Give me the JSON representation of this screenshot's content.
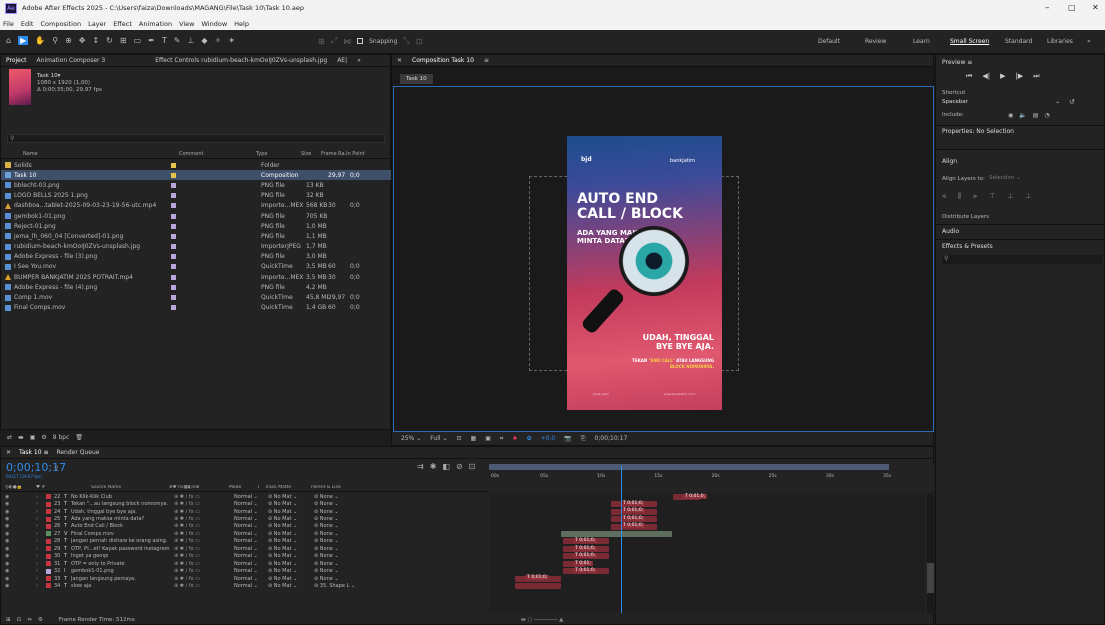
{
  "app": {
    "title": "Adobe After Effects 2025 - C:\\Users\\faiza\\Downloads\\MAGANG\\File\\Task 10\\Task 10.aep",
    "logo": "Ae",
    "menu": [
      "File",
      "Edit",
      "Composition",
      "Layer",
      "Effect",
      "Animation",
      "View",
      "Window",
      "Help"
    ],
    "window_controls": {
      "minimize": "–",
      "restore": "▢",
      "close": "✕"
    }
  },
  "toolbar": {
    "snapping": "Snapping",
    "workspaces": [
      "Default",
      "Review",
      "Learn",
      "Small Screen",
      "Standard",
      "Libraries"
    ],
    "active_workspace": "Small Screen",
    "more": "»"
  },
  "project": {
    "tabs": [
      "Project",
      "Animation Composer 3",
      "Effect Controls rubidium-beach-kmOoIJ0ZVs-unsplash.jpg",
      "AE|",
      "»"
    ],
    "preview_name": "Task 10▾",
    "preview_dims": "1080 x 1920 (1,00)",
    "preview_dur": "Δ 0;00;35;00, 29,97 fps",
    "search_placeholder": "",
    "columns": [
      "Name",
      "Comment",
      "Type",
      "Size",
      "Frame Ra...",
      "In Point"
    ],
    "items": [
      {
        "name": "Solids",
        "type": "Folder",
        "size": "",
        "fps": "",
        "in": "",
        "icon": "folder-icon",
        "label": "#e6c34a"
      },
      {
        "name": "Task 10",
        "type": "Composition",
        "size": "",
        "fps": "29,97",
        "in": "0;0",
        "icon": "composition-icon",
        "label": "#e6c34a",
        "selected": true
      },
      {
        "name": "bblecht-03.png",
        "type": "PNG file",
        "size": "13 KB",
        "fps": "",
        "in": "",
        "icon": "image-icon",
        "label": "#b9a6d9"
      },
      {
        "name": "LOGO BELLS 2025 1.png",
        "type": "PNG file",
        "size": "32 KB",
        "fps": "",
        "in": "",
        "icon": "image-icon",
        "label": "#b9a6d9"
      },
      {
        "name": "dashboa...tablet-2025-09-03-23-19-56-utc.mp4",
        "type": "Importe...MEX",
        "size": "568 KB",
        "fps": "30",
        "in": "0;0",
        "icon": "warning-icon",
        "label": "#b9a6d9"
      },
      {
        "name": "gembok1-01.png",
        "type": "PNG file",
        "size": "705 KB",
        "fps": "",
        "in": "",
        "icon": "image-icon",
        "label": "#b9a6d9"
      },
      {
        "name": "Reject-01.png",
        "type": "PNG file",
        "size": "1,0 MB",
        "fps": "",
        "in": "",
        "icon": "image-icon",
        "label": "#b9a6d9"
      },
      {
        "name": "jema_lh_060_04 [Converted]-01.png",
        "type": "PNG file",
        "size": "1,1 MB",
        "fps": "",
        "in": "",
        "icon": "image-icon",
        "label": "#b9a6d9"
      },
      {
        "name": "rubidium-beach-kmOoIJ0ZVs-unsplash.jpg",
        "type": "ImporterJPEG",
        "size": "1,7 MB",
        "fps": "",
        "in": "",
        "icon": "image-icon",
        "label": "#b9a6d9"
      },
      {
        "name": "Adobe Express - file (3).png",
        "type": "PNG file",
        "size": "3,0 MB",
        "fps": "",
        "in": "",
        "icon": "image-icon",
        "label": "#b9a6d9"
      },
      {
        "name": "I See You.mov",
        "type": "QuickTime",
        "size": "3,5 MB",
        "fps": "60",
        "in": "0;0",
        "icon": "video-icon",
        "label": "#b9a6d9"
      },
      {
        "name": "BUMPER BANKJATIM 2025 POTRAIT.mp4",
        "type": "Importe...MEX",
        "size": "3,5 MB",
        "fps": "30",
        "in": "0;0",
        "icon": "warning-icon",
        "label": "#b9a6d9"
      },
      {
        "name": "Adobe Express - file (4).png",
        "type": "PNG file",
        "size": "4,2 MB",
        "fps": "",
        "in": "",
        "icon": "image-icon",
        "label": "#b9a6d9"
      },
      {
        "name": "Comp 1.mov",
        "type": "QuickTime",
        "size": "45,8 MB",
        "fps": "29,97",
        "in": "0;0",
        "icon": "video-icon",
        "label": "#b9a6d9"
      },
      {
        "name": "Final Comps.mov",
        "type": "QuickTime",
        "size": "1,4 GB",
        "fps": "60",
        "in": "0;0",
        "icon": "video-icon",
        "label": "#b9a6d9"
      }
    ],
    "footer_bpc": "8 bpc"
  },
  "comp": {
    "tab": "Composition Task 10",
    "sub_tab": "Task 10",
    "poster": {
      "logo_left": "bjd",
      "logo_right": "bankjatim",
      "headline1": "AUTO END",
      "headline2": "CALL / BLOCK",
      "sub1": "ADA YANG MAKSA",
      "sub2": "MINTA DATA?",
      "cta1": "UDAH, TINGGAL",
      "cta2": "BYE BYE AJA.",
      "small_pre": "TEKAN ",
      "small_hl": "\"END CALL\"",
      "small_post": " ATAU LANGSUNG",
      "small2": "BLOCK NOMORNYA.",
      "foot_left": "bank jatim",
      "foot_right": "www.bankjatim.co.id"
    },
    "footer": {
      "zoom": "25%",
      "res": "Full",
      "exposure": "+0,0",
      "time": "0;00;10;17"
    }
  },
  "right": {
    "preview_title": "Preview",
    "shortcut_label": "Shortcut",
    "shortcut_value": "Spacebar",
    "include_label": "Include:",
    "properties_title": "Properties: No Selection",
    "align_title": "Align",
    "align_layers_label": "Align Layers to:",
    "align_layers_value": "Selection",
    "distribute": "Distribute Layers",
    "audio": "Audio",
    "effects": "Effects & Presets"
  },
  "timeline": {
    "tab": "Task 10",
    "render_queue": "Render Queue",
    "timecode": "0;00;10;17",
    "frames": "00317 (29.97 fps)",
    "ruler": [
      "00s",
      "05s",
      "10s",
      "15s",
      "20s",
      "25s",
      "30s",
      "35s"
    ],
    "columns": {
      "source": "Source Name",
      "mode": "Mode",
      "t": "T",
      "trkmat": "Track Matte",
      "parent": "Parent & Link"
    },
    "layers": [
      {
        "num": "22",
        "name": "No Klik-Klik Club",
        "type": "T",
        "color": "#c4363f",
        "mode": "Normal",
        "matte": "No Mat",
        "parent": "None",
        "bar": [
          0.422,
          0.484
        ],
        "tag": "T 0;01;0;"
      },
      {
        "num": "23",
        "name": "Tekan \"...au langsung block nomornya.",
        "type": "T",
        "color": "#c4363f",
        "mode": "Normal",
        "matte": "No Mat",
        "parent": "None",
        "bar": [
          0.28,
          0.385
        ],
        "tag": "T 0;01;0;"
      },
      {
        "num": "24",
        "name": "Udah, tinggal bye bye aja.",
        "type": "T",
        "color": "#c4363f",
        "mode": "Normal",
        "matte": "No Mat",
        "parent": "None",
        "bar": [
          0.28,
          0.385
        ],
        "tag": "T 0;01;0;"
      },
      {
        "num": "25",
        "name": "Ada yang maksa minta data?",
        "type": "T",
        "color": "#c4363f",
        "mode": "Normal",
        "matte": "No Mat",
        "parent": "None",
        "bar": [
          0.28,
          0.385
        ],
        "tag": "T 0;01;0;"
      },
      {
        "num": "26",
        "name": "Auto End Call / Block",
        "type": "T",
        "color": "#c4363f",
        "mode": "Normal",
        "matte": "No Mat",
        "parent": "None",
        "bar": [
          0.28,
          0.385
        ],
        "tag": "T 0;01;0;"
      },
      {
        "num": "27",
        "name": "Final Comps.mov",
        "type": "V",
        "color": "#5d8b5d",
        "mode": "Normal",
        "matte": "No Mat",
        "parent": "None",
        "bar": [
          0.165,
          0.42
        ],
        "tag": ""
      },
      {
        "num": "28",
        "name": "Jangan pernah dishare ke orang asing.",
        "type": "T",
        "color": "#c4363f",
        "mode": "Normal",
        "matte": "No Mat",
        "parent": "None",
        "bar": [
          0.17,
          0.275
        ],
        "tag": "T 0;01;0;"
      },
      {
        "num": "29",
        "name": "OTP, PI...et! Kayak password instagram",
        "type": "T",
        "color": "#c4363f",
        "mode": "Normal",
        "matte": "No Mat",
        "parent": "None",
        "bar": [
          0.17,
          0.275
        ],
        "tag": "T 0;01;0;"
      },
      {
        "num": "30",
        "name": "Inget ya genqs",
        "type": "T",
        "color": "#c4363f",
        "mode": "Normal",
        "matte": "No Mat",
        "parent": "None",
        "bar": [
          0.17,
          0.275
        ],
        "tag": "T 0;01;0;"
      },
      {
        "num": "31",
        "name": "OTP = only to Private",
        "type": "T",
        "color": "#c4363f",
        "mode": "Normal",
        "matte": "No Mat",
        "parent": "None",
        "bar": [
          0.17,
          0.22
        ],
        "tag": "T 0;01;"
      },
      {
        "num": "32",
        "name": "gembok1-01.png",
        "type": "I",
        "color": "#b9a6d9",
        "mode": "Normal",
        "matte": "No Mat",
        "parent": "None",
        "bar": [
          0.17,
          0.275
        ],
        "tag": "T 0;01;0;"
      },
      {
        "num": "33",
        "name": "Jangan langsung percaya.",
        "type": "T",
        "color": "#c4363f",
        "mode": "Normal",
        "matte": "No Mat",
        "parent": "None",
        "bar": [
          0.06,
          0.165
        ],
        "tag": "T 0;01;0;"
      },
      {
        "num": "34",
        "name": "slow aja",
        "type": "T",
        "color": "#c4363f",
        "mode": "Normal",
        "matte": "No Mat",
        "parent": "35. Shape L",
        "bar": [
          0.06,
          0.165
        ],
        "tag": ""
      }
    ],
    "playhead": 0.302,
    "footer": "Frame Render Time: 512ms"
  },
  "colors": {
    "accent": "#2d8ceb",
    "label_red": "#c4363f",
    "bar_red": "#8b2e38",
    "workarea": "#4d5a73"
  }
}
